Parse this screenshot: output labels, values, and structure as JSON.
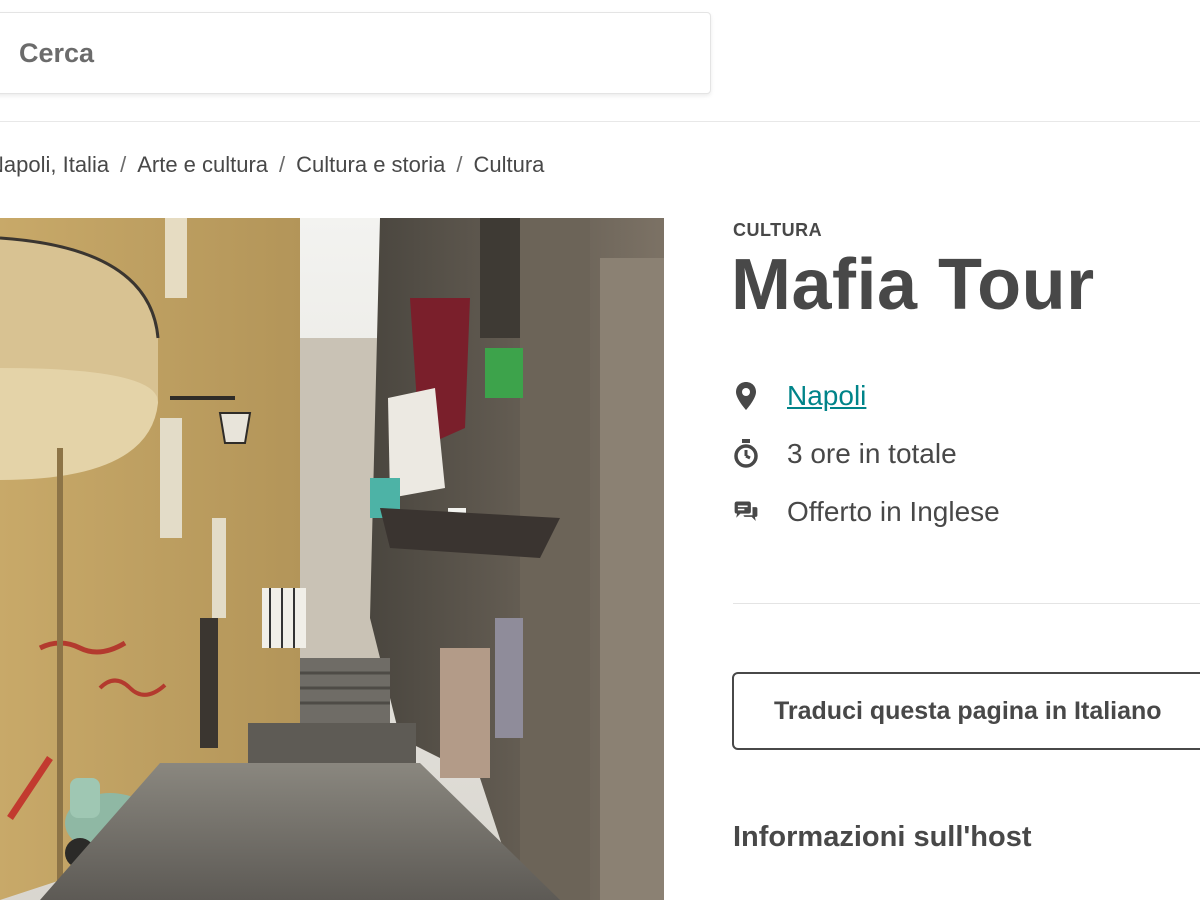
{
  "search": {
    "placeholder": "Cerca",
    "value": ""
  },
  "breadcrumb": {
    "items": [
      "Napoli, Italia",
      "Arte e cultura",
      "Cultura e storia",
      "Cultura"
    ],
    "separator": "/"
  },
  "hero_image": {
    "description_icon": "photo"
  },
  "experience": {
    "category": "CULTURA",
    "title": "Mafia Tour",
    "location": {
      "icon": "map-pin-icon",
      "text": "Napoli"
    },
    "duration": {
      "icon": "stopwatch-icon",
      "text": "3 ore in totale"
    },
    "language": {
      "icon": "chat-bubbles-icon",
      "text": "Offerto in Inglese"
    }
  },
  "translate_button": {
    "label": "Traduci questa pagina in Italiano"
  },
  "host_section": {
    "heading": "Informazioni sull'host"
  },
  "colors": {
    "text": "#484848",
    "link": "#008489",
    "divider": "#e4e4e4",
    "button_border": "#484848"
  }
}
